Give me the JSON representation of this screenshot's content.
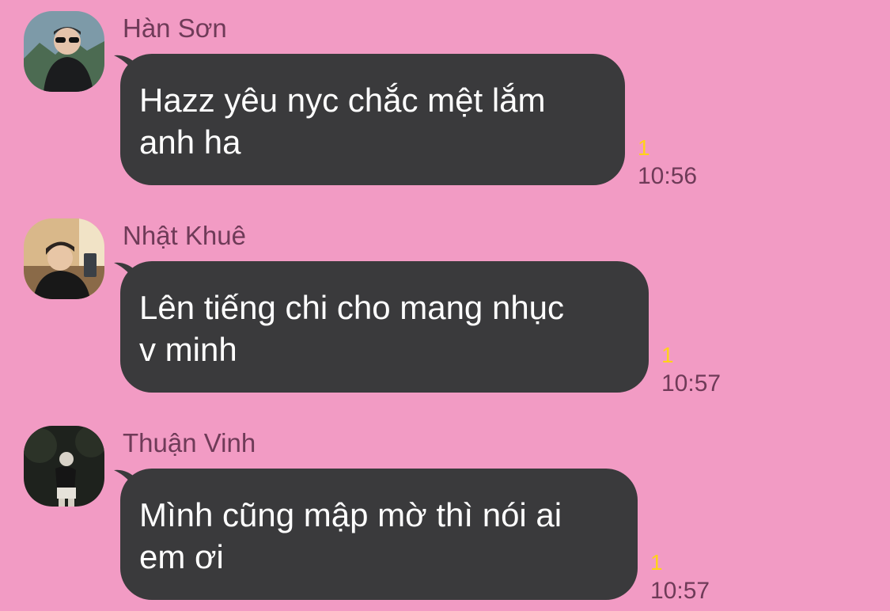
{
  "colors": {
    "background": "#f29bc4",
    "bubble": "#3a3a3c",
    "bubble_text": "#ffffff",
    "meta_text": "#6f3b58",
    "unread": "#ffd21a"
  },
  "messages": [
    {
      "sender": "Hàn Sơn",
      "avatar": "avatar-photo-icon",
      "lines": [
        "Hazz yêu nyc chắc mệt lắm",
        "anh ha"
      ],
      "unread": "1",
      "time": "10:56"
    },
    {
      "sender": "Nhật Khuê",
      "avatar": "avatar-photo-icon",
      "lines": [
        "Lên tiếng chi cho mang nhục",
        "v minh"
      ],
      "unread": "1",
      "time": "10:57"
    },
    {
      "sender": "Thuận Vinh",
      "avatar": "avatar-photo-icon",
      "lines": [
        "Mình cũng mập mờ thì nói ai",
        "em ơi"
      ],
      "unread": "1",
      "time": "10:57"
    }
  ]
}
